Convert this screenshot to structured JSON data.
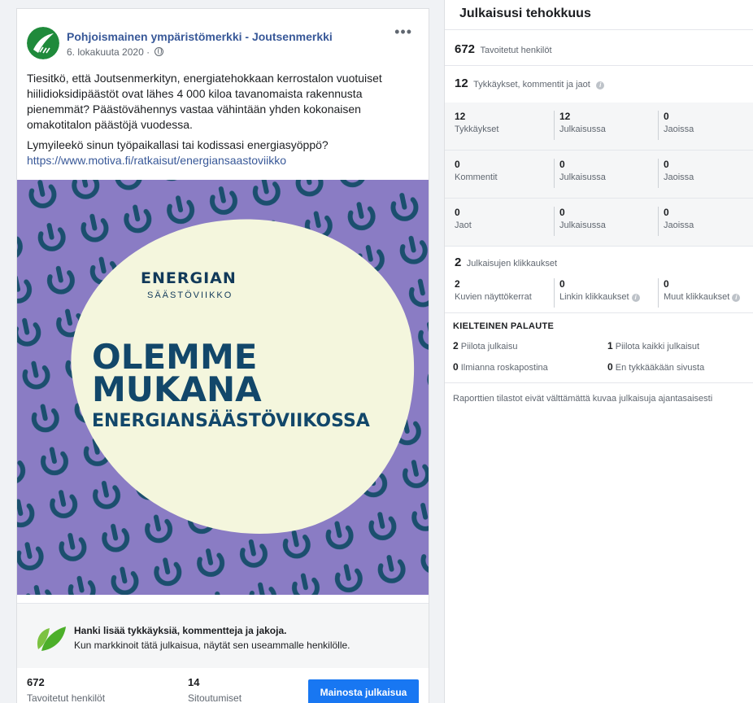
{
  "post": {
    "page_name": "Pohjoismainen ympäristömerkki - Joutsenmerkki",
    "date": "6. lokakuuta 2020 ·",
    "more_label": "•••",
    "paragraph1": "Tiesitkö, että Joutsenmerkityn, energiatehokkaan kerrostalon vuotuiset hiilidioksidipäästöt ovat lähes 4 000 kiloa tavanomaista rakennusta pienemmät? Päästövähennys vastaa vähintään yhden kokonaisen omakotitalon päästöjä vuodessa.",
    "paragraph2": "Lymyileekö sinun työpaikallasi tai kodissasi energiasyöppö?",
    "link": "https://www.motiva.fi/ratkaisut/energiansaastoviikko",
    "image": {
      "logo": "ENERGIAN",
      "logo_sub": "SÄÄSTÖVIIKKO",
      "headline_line1": "OLEMME",
      "headline_line2": "MUKANA",
      "headline_line3": "ENERGIANSÄÄSTÖVIIKOSSA",
      "background_color": "#8a7cc4",
      "blob_color": "#f4f6dd",
      "text_color": "#12476a"
    },
    "promo": {
      "title": "Hanki lisää tykkäyksiä, kommentteja ja jakoja.",
      "text": "Kun markkinoit tätä julkaisua, näytät sen useammalle henkilölle."
    },
    "stats": [
      {
        "value": "672",
        "label": "Tavoitetut henkilöt"
      },
      {
        "value": "14",
        "label": "Sitoutumiset"
      }
    ],
    "boost_label": "Mainosta julkaisua"
  },
  "insights": {
    "title": "Julkaisusi tehokkuus",
    "reach": {
      "value": "672",
      "label": "Tavoitetut henkilöt"
    },
    "engagement": {
      "value": "12",
      "label": "Tykkäykset, kommentit ja jaot"
    },
    "grid": [
      {
        "cells": [
          {
            "value": "12",
            "label": "Tykkäykset"
          },
          {
            "value": "12",
            "label": "Julkaisussa"
          },
          {
            "value": "0",
            "label": "Jaoissa"
          }
        ]
      },
      {
        "cells": [
          {
            "value": "0",
            "label": "Kommentit"
          },
          {
            "value": "0",
            "label": "Julkaisussa"
          },
          {
            "value": "0",
            "label": "Jaoissa"
          }
        ]
      },
      {
        "cells": [
          {
            "value": "0",
            "label": "Jaot"
          },
          {
            "value": "0",
            "label": "Julkaisussa"
          },
          {
            "value": "0",
            "label": "Jaoissa"
          }
        ]
      }
    ],
    "clicks": {
      "value": "2",
      "label": "Julkaisujen klikkaukset"
    },
    "click_cells": [
      {
        "value": "2",
        "label": "Kuvien näyttökerrat"
      },
      {
        "value": "0",
        "label": "Linkin klikkaukset"
      },
      {
        "value": "0",
        "label": "Muut klikkaukset"
      }
    ],
    "negative": {
      "title": "KIELTEINEN PALAUTE",
      "items": [
        {
          "value": "2",
          "label": "Piilota julkaisu"
        },
        {
          "value": "1",
          "label": "Piilota kaikki julkaisut"
        },
        {
          "value": "0",
          "label": "Ilmianna roskapostina"
        },
        {
          "value": "0",
          "label": "En tykkääkään sivusta"
        }
      ]
    },
    "disclaimer": "Raporttien tilastot eivät välttämättä kuvaa julkaisuja ajantasaisesti",
    "info_glyph": "i"
  },
  "colors": {
    "link": "#385898",
    "button": "#1877f2",
    "muted": "#606770"
  }
}
